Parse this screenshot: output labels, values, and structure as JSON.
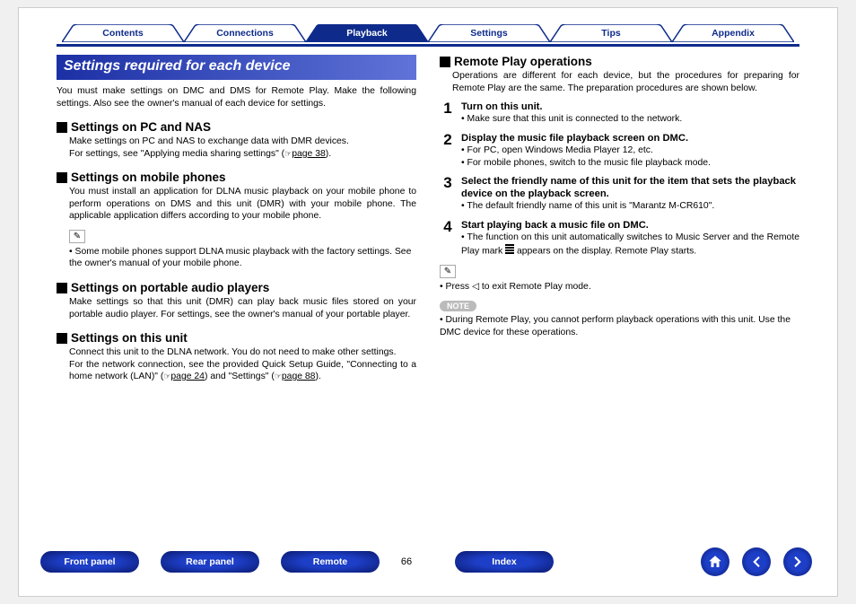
{
  "tabs": {
    "items": [
      "Contents",
      "Connections",
      "Playback",
      "Settings",
      "Tips",
      "Appendix"
    ],
    "active_index": 2
  },
  "left": {
    "banner": "Settings required for each device",
    "intro": "You must make settings on DMC and DMS for Remote Play. Make the following settings. Also see the owner's manual of each device for settings.",
    "pc_nas": {
      "title": "Settings on PC and NAS",
      "body_a": "Make settings on PC and NAS to exchange data with DMR devices.",
      "body_b": "For settings, see \"Applying media sharing settings\" (",
      "link": "page 38",
      "body_c": ")."
    },
    "mobile": {
      "title": "Settings on mobile phones",
      "body": "You must install an application for DLNA music playback on your mobile phone to perform operations on DMS and this unit (DMR) with your mobile phone. The applicable application differs according to your mobile phone.",
      "tip": "Some mobile phones support DLNA music playback with the factory settings. See the owner's manual of your mobile phone."
    },
    "portable": {
      "title": "Settings on portable audio players",
      "body": "Make settings so that this unit (DMR) can play back music files stored on your portable audio player. For settings, see the owner's manual of your portable player."
    },
    "unit": {
      "title": "Settings on this unit",
      "body_a": "Connect this unit to the DLNA network. You do not need to make other settings.",
      "body_b": "For the network connection, see the provided Quick Setup Guide, \"Connecting to a home network (LAN)\" (",
      "link1": "page 24",
      "body_c": ") and \"Settings\" (",
      "link2": "page 88",
      "body_d": ")."
    }
  },
  "right": {
    "title": "Remote Play operations",
    "intro": "Operations are different for each device, but the procedures for preparing for Remote Play are the same. The preparation procedures are shown below.",
    "steps": [
      {
        "num": "1",
        "title": "Turn on this unit.",
        "bullets": [
          "Make sure that this unit is connected to the network."
        ]
      },
      {
        "num": "2",
        "title": "Display the music file playback screen on DMC.",
        "bullets": [
          "For PC, open Windows Media Player 12, etc.",
          "For mobile phones, switch to the music file playback mode."
        ]
      },
      {
        "num": "3",
        "title": "Select the friendly name of this unit for the item that sets the playback device on the playback screen.",
        "bullets": [
          "The default friendly name of this unit is \"Marantz M-CR610\"."
        ]
      },
      {
        "num": "4",
        "title": "Start playing back a music file on DMC.",
        "bullets_icon": [
          "The function on this unit automatically switches to Music Server and the Remote Play mark  ",
          "  appears on the display. Remote Play starts."
        ]
      }
    ],
    "tip": "Press ◁ to exit Remote Play mode.",
    "note_label": "NOTE",
    "note": "During Remote Play, you cannot perform playback operations with this unit. Use the DMC device for these operations."
  },
  "footer": {
    "buttons": [
      "Front panel",
      "Rear panel",
      "Remote",
      "Index"
    ],
    "pagenum": "66",
    "icons": {
      "home": "home-icon",
      "left": "arrow-left-icon",
      "right": "arrow-right-icon"
    }
  }
}
